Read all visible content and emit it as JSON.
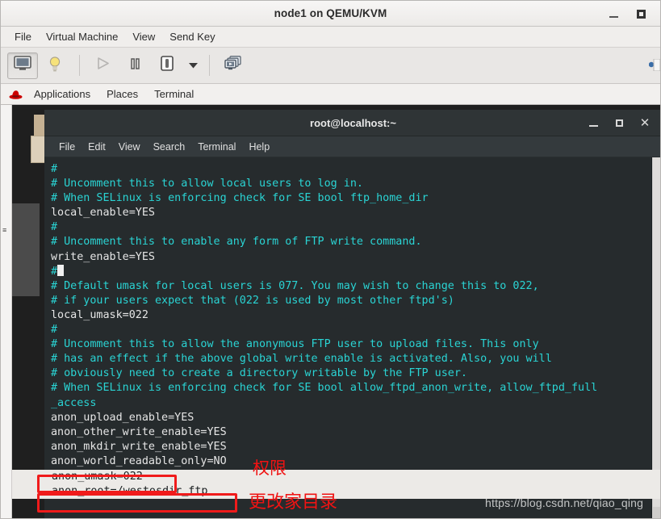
{
  "vm_window": {
    "title": "node1 on QEMU/KVM",
    "controls": {
      "minimize": "–",
      "maximize": "□"
    },
    "menubar": [
      "File",
      "Virtual Machine",
      "View",
      "Send Key"
    ],
    "toolbar": {
      "console_view_icon": "monitor-icon",
      "details_icon": "lightbulb-icon",
      "run_icon": "play-icon",
      "pause_icon": "pause-icon",
      "shutdown_icon": "power-icon",
      "shutdown_menu_icon": "chevron-down-icon",
      "snapshots_icon": "snapshots-icon",
      "right_edge_icon": "partial-blue-icon"
    }
  },
  "gnome_panel": {
    "logo_icon": "redhat-fedora-icon",
    "items": [
      "Applications",
      "Places",
      "Terminal"
    ]
  },
  "terminal": {
    "title": "root@localhost:~",
    "controls": {
      "minimize": "–",
      "maximize": "□",
      "close": "✕"
    },
    "menubar": [
      "File",
      "Edit",
      "View",
      "Search",
      "Terminal",
      "Help"
    ],
    "lines": [
      {
        "text": "#",
        "type": "comment"
      },
      {
        "text": "# Uncomment this to allow local users to log in.",
        "type": "comment"
      },
      {
        "text": "# When SELinux is enforcing check for SE bool ftp_home_dir",
        "type": "comment"
      },
      {
        "text": "local_enable=YES",
        "type": "value"
      },
      {
        "text": "#",
        "type": "comment"
      },
      {
        "text": "# Uncomment this to enable any form of FTP write command.",
        "type": "comment"
      },
      {
        "text": "write_enable=YES",
        "type": "value"
      },
      {
        "text": "#",
        "type": "comment",
        "cursor": true
      },
      {
        "text": "# Default umask for local users is 077. You may wish to change this to 022,",
        "type": "comment"
      },
      {
        "text": "# if your users expect that (022 is used by most other ftpd's)",
        "type": "comment"
      },
      {
        "text": "local_umask=022",
        "type": "value"
      },
      {
        "text": "#",
        "type": "comment"
      },
      {
        "text": "# Uncomment this to allow the anonymous FTP user to upload files. This only",
        "type": "comment"
      },
      {
        "text": "# has an effect if the above global write enable is activated. Also, you will",
        "type": "comment"
      },
      {
        "text": "# obviously need to create a directory writable by the FTP user.",
        "type": "comment"
      },
      {
        "text": "# When SELinux is enforcing check for SE bool allow_ftpd_anon_write, allow_ftpd_full",
        "type": "comment"
      },
      {
        "text": "_access",
        "type": "comment"
      },
      {
        "text": "anon_upload_enable=YES",
        "type": "value"
      },
      {
        "text": "anon_other_write_enable=YES",
        "type": "value"
      },
      {
        "text": "anon_mkdir_write_enable=YES",
        "type": "value"
      },
      {
        "text": "anon_world_readable_only=NO",
        "type": "value"
      },
      {
        "text": "anon_umask=022",
        "type": "value"
      },
      {
        "text": "anon_root=/westosdir_ftp",
        "type": "value"
      }
    ],
    "highlighted_lines": [
      "anon_umask=022",
      "anon_root=/westosdir_ftp"
    ]
  },
  "annotations": {
    "note_permissions": "权限",
    "note_change_home_dir": "更改家目录",
    "watermark": "https://blog.csdn.net/qiao_qing",
    "box_color": "#f01b1b",
    "note_color": "#f01313"
  }
}
